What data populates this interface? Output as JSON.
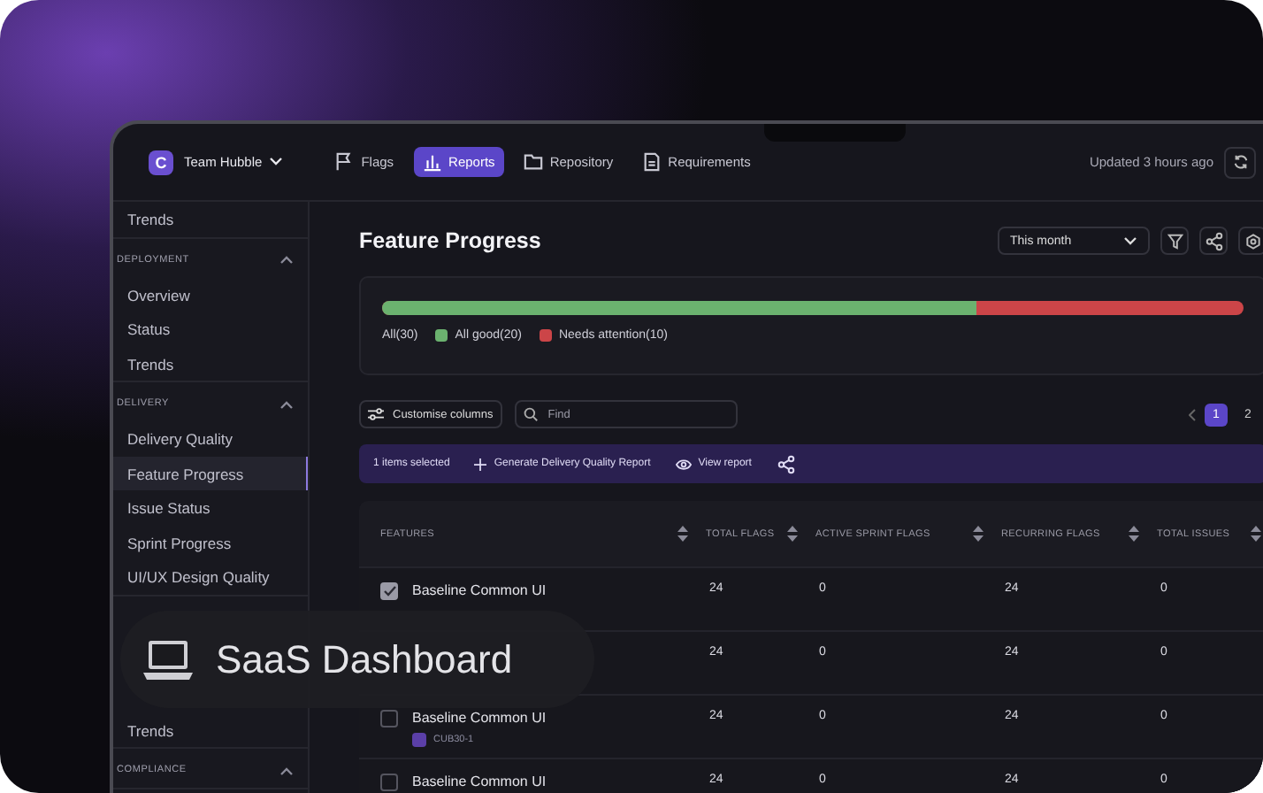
{
  "topbar": {
    "team": "Team Hubble",
    "logo": "C",
    "nav": [
      {
        "label": "Flags",
        "selected": false
      },
      {
        "label": "Reports",
        "selected": true
      },
      {
        "label": "Repository",
        "selected": false
      },
      {
        "label": "Requirements",
        "selected": false
      }
    ],
    "updated": "Updated 3 hours ago"
  },
  "sidebar": {
    "groups": [
      {
        "items": [
          {
            "label": "Trends",
            "selected": false
          }
        ]
      },
      {
        "title": "DEPLOYMENT",
        "expanded": true,
        "items": [
          {
            "label": "Overview",
            "selected": false
          },
          {
            "label": "Status",
            "selected": false
          },
          {
            "label": "Trends",
            "selected": false
          }
        ]
      },
      {
        "title": "DELIVERY",
        "expanded": true,
        "items": [
          {
            "label": "Delivery Quality",
            "selected": false
          },
          {
            "label": "Feature Progress",
            "selected": true
          },
          {
            "label": "Issue Status",
            "selected": false
          },
          {
            "label": "Sprint Progress",
            "selected": false
          },
          {
            "label": "UI/UX Design Quality",
            "selected": false
          }
        ]
      },
      {
        "items": [
          {
            "label": "Trends",
            "selected": false
          }
        ]
      },
      {
        "title": "COMPLIANCE",
        "expanded": true
      }
    ]
  },
  "page": {
    "title": "Feature Progress",
    "period": "This month",
    "progress": {
      "level": 0.69,
      "legend": [
        {
          "label": "All(30)"
        },
        {
          "label": "All good(20)",
          "color": "#6bb26f"
        },
        {
          "label": "Needs attention(10)",
          "color": "#cc4548"
        }
      ]
    },
    "customise": "Customise columns",
    "search": {
      "placeholder": "Find"
    },
    "pagination": [
      {
        "label": "1",
        "selected": true
      },
      {
        "label": "2",
        "selected": false
      }
    ],
    "selection": {
      "count": "1 items selected",
      "generate": "Generate Delivery Quality Report",
      "view": "View report"
    },
    "table": {
      "columns": [
        "FEATURES",
        "TOTAL FLAGS",
        "ACTIVE SPRINT FLAGS",
        "RECURRING FLAGS",
        "TOTAL ISSUES"
      ],
      "rows": [
        {
          "checked": true,
          "cells": [
            "Baseline Common UI",
            "24",
            "0",
            "24",
            "0"
          ]
        },
        {
          "cells": [
            "",
            "24",
            "0",
            "24",
            "0"
          ]
        },
        {
          "checked": false,
          "tag": "CUB30-1",
          "cells": [
            "Baseline Common UI",
            "24",
            "0",
            "24",
            "0"
          ]
        },
        {
          "checked": false,
          "cells": [
            "Baseline Common UI",
            "24",
            "0",
            "24",
            "0"
          ]
        }
      ]
    }
  },
  "badge": {
    "label": "SaaS Dashboard"
  }
}
